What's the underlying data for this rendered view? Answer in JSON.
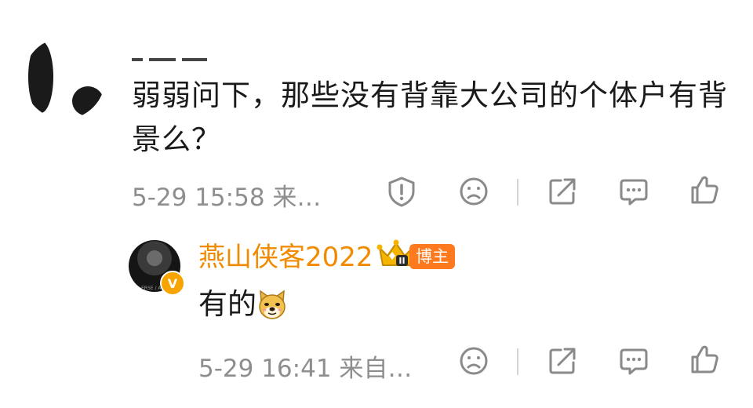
{
  "comment": {
    "text": "弱弱问下，那些没有背靠大公司的个体户有背景么？",
    "meta": "5-29 15:58 来…",
    "icons": [
      "report-icon",
      "frown-icon",
      "share-icon",
      "comment-icon",
      "like-icon"
    ]
  },
  "reply": {
    "username": "燕山侠客2022",
    "badge_label": "博主",
    "crown_level": "II",
    "verified_mark": "V",
    "text": "有的",
    "emoji": "doge-emoji",
    "meta": "5-29 16:41 来自…",
    "icons": [
      "frown-icon",
      "share-icon",
      "comment-icon",
      "like-icon"
    ]
  },
  "colors": {
    "username": "#f28a00",
    "badge": "#ff7a1f",
    "verified": "#f7a300",
    "meta": "#8e8e8e",
    "icon": "#8a8a8a"
  }
}
